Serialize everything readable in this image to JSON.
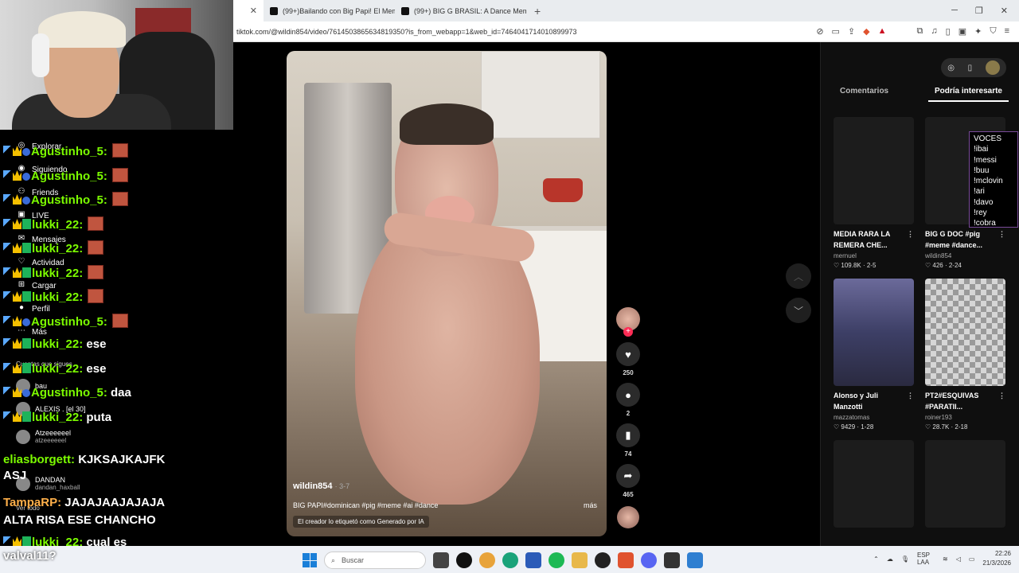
{
  "browser": {
    "tabs": [
      {
        "label": ""
      },
      {
        "label": "(99+)Bailando con Big Papi! El Mem"
      },
      {
        "label": "(99+) BIG G BRASIL: A Dance Meme"
      }
    ],
    "url": "tiktok.com/@wildin854/video/7614503865634819350?is_from_webapp=1&web_id=7464041714010899973"
  },
  "video": {
    "username": "wildin854",
    "date": "· 3-7",
    "description": "BIG PAPI#dominican #pig #meme #ai #dance",
    "more_label": "más",
    "ai_label": "El creador lo etiquetó como Generado por IA"
  },
  "actions": {
    "likes": "250",
    "comments": "2",
    "saves": "74",
    "shares": "465"
  },
  "panel": {
    "tabs": [
      "Comentarios",
      "Podría interesarte"
    ],
    "cards": [
      {
        "title": "MEDIA RARA LA REMERA CHE...",
        "author": "mernuel",
        "stats": "♡ 109.8K · 2-5"
      },
      {
        "title": "BIG G DOC #pig #meme #dance...",
        "author": "wildin854",
        "stats": "♡ 426 · 2-24"
      },
      {
        "title": "Alonso y Juli Manzotti",
        "author": "mazzatomas",
        "stats": "♡ 9429 · 1-28"
      },
      {
        "title": "PT2#ESQUIVAS #PARATII...",
        "author": "roiner193",
        "stats": "♡ 28.7K · 2-18"
      }
    ]
  },
  "voces": [
    "VOCES",
    "!ibai",
    "!messi",
    "!buu",
    "!mclovin",
    "!ari",
    "!davo",
    "!rey",
    "!cobra"
  ],
  "sidebar": {
    "items": [
      "Explorar",
      "Siguiendo",
      "Friends",
      "LIVE",
      "Mensajes",
      "Actividad",
      "Cargar",
      "Perfil",
      "Más"
    ],
    "following_label": "Cuentas que sigues",
    "see_all": "Ver todo",
    "follows": [
      {
        "name": "bau",
        "handle": ""
      },
      {
        "name": "ALEXIS . [el 30]",
        "handle": ""
      },
      {
        "name": "Atzeeeeeel",
        "handle": "atzeeeeeel"
      },
      {
        "name": "DANDAN",
        "handle": "dandan_haxball"
      }
    ]
  },
  "chat": [
    {
      "user": "Agustinho_5:",
      "text": ""
    },
    {
      "user": "Agustinho_5:",
      "text": ""
    },
    {
      "user": "Agustinho_5:",
      "text": ""
    },
    {
      "user": "lukki_22:",
      "text": ""
    },
    {
      "user": "lukki_22:",
      "text": ""
    },
    {
      "user": "lukki_22:",
      "text": ""
    },
    {
      "user": "lukki_22:",
      "text": ""
    },
    {
      "user": "Agustinho_5:",
      "text": ""
    },
    {
      "user": "lukki_22:",
      "text": "ese"
    },
    {
      "user": "lukki_22:",
      "text": "ese"
    },
    {
      "user": "Agustinho_5:",
      "text": "daa"
    },
    {
      "user": "lukki_22:",
      "text": "puta"
    },
    {
      "user": "eliasborgett:",
      "text": "KJKSAJKAJFK ASJ"
    },
    {
      "user": "TampaRP:",
      "text": "JAJAJAAJAJAJA ALTA RISA ESE CHANCHO"
    },
    {
      "user": "lukki_22:",
      "text": "cual es"
    }
  ],
  "chat_tail": "valval11?",
  "taskbar": {
    "search_placeholder": "Buscar",
    "lang": "ESP LAA",
    "time": "22:26",
    "date": "21/3/2026"
  }
}
